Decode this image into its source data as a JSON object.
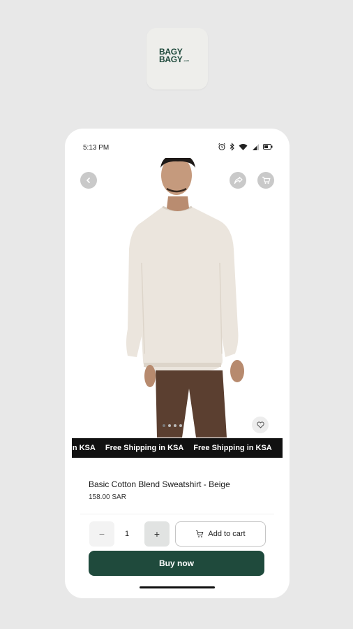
{
  "app_icon": {
    "logo_line1": "BAGY",
    "logo_line2": "BAGY",
    "logo_suffix": ".com"
  },
  "status_bar": {
    "time": "5:13 PM",
    "icons": [
      "alarm-icon",
      "bluetooth-icon",
      "wifi-icon",
      "signal-icon",
      "battery-icon"
    ]
  },
  "hero": {
    "icons": {
      "back": "chevron-left-icon",
      "share": "share-icon",
      "cart": "cart-icon",
      "wishlist": "heart-icon"
    },
    "image_count": 4,
    "active_image": 1
  },
  "marquee": {
    "items": [
      "g in KSA",
      "Free Shipping in KSA",
      "Free Shipping in KSA"
    ]
  },
  "product": {
    "title": "Basic Cotton Blend Sweatshirt - Beige",
    "price": "158.00 SAR"
  },
  "cart": {
    "minus_label": "−",
    "quantity": "1",
    "plus_label": "+",
    "add_to_cart_label": "Add to cart",
    "buy_now_label": "Buy now"
  },
  "colors": {
    "brand": "#1f4a3c",
    "marquee_bg": "#111111",
    "page_bg": "#e8e8e8"
  }
}
